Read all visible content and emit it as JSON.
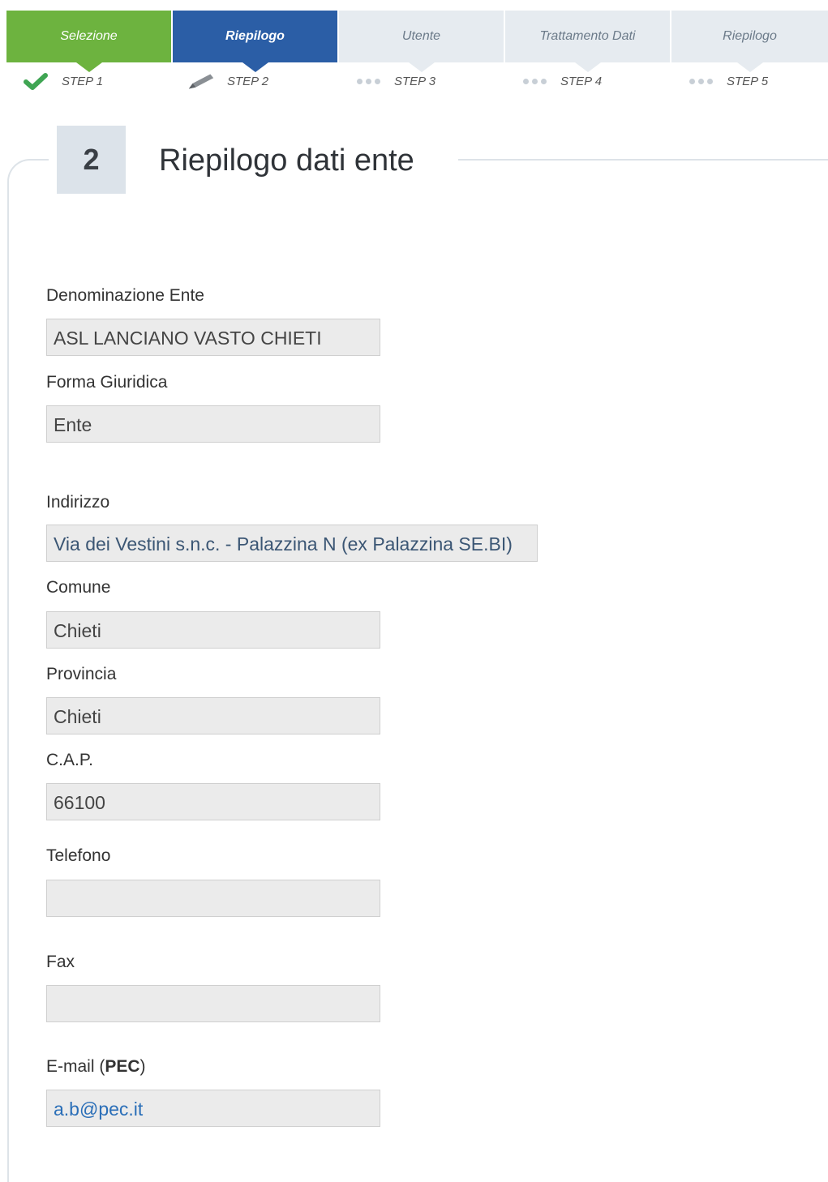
{
  "stepper": {
    "tabs": [
      {
        "label": "Selezione",
        "step": "STEP 1",
        "state": "done"
      },
      {
        "label": "Riepilogo",
        "step": "STEP 2",
        "state": "active"
      },
      {
        "label": "Utente",
        "step": "STEP 3",
        "state": "todo"
      },
      {
        "label": "Trattamento Dati",
        "step": "STEP 4",
        "state": "todo"
      },
      {
        "label": "Riepilogo",
        "step": "STEP 5",
        "state": "todo"
      }
    ],
    "icons": {
      "done": "checkmark-icon",
      "active": "pencil-icon",
      "todo": "dots-icon"
    },
    "colors": {
      "done": "#6db33f",
      "active": "#2b5ea6",
      "todo": "#e6ebf0"
    }
  },
  "section": {
    "number": "2",
    "title": "Riepilogo dati ente"
  },
  "fields": {
    "denominazione": {
      "label": "Denominazione Ente",
      "value": "ASL LANCIANO VASTO CHIETI"
    },
    "forma_giuridica": {
      "label": "Forma Giuridica",
      "value": "Ente"
    },
    "indirizzo": {
      "label": "Indirizzo",
      "value": "Via dei Vestini s.n.c. - Palazzina N (ex Palazzina SE.BI)"
    },
    "comune": {
      "label": "Comune",
      "value": "Chieti"
    },
    "provincia": {
      "label": "Provincia",
      "value": "Chieti"
    },
    "cap": {
      "label": "C.A.P.",
      "value": "66100"
    },
    "telefono": {
      "label": "Telefono",
      "value": ""
    },
    "fax": {
      "label": "Fax",
      "value": ""
    },
    "email": {
      "label_prefix": "E-mail (",
      "label_bold": "PEC",
      "label_suffix": ")",
      "value": "a.b@pec.it"
    }
  }
}
